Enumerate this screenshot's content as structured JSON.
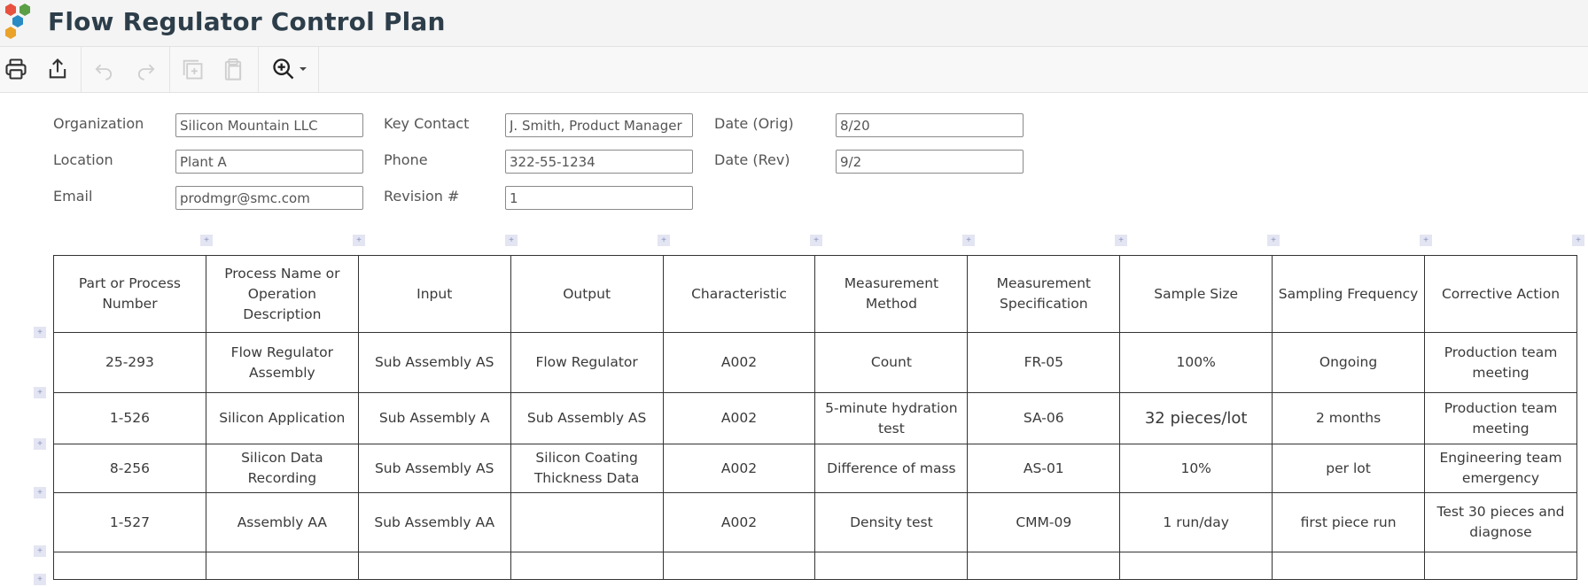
{
  "app": {
    "title": "Flow Regulator Control Plan",
    "logo_icon": "hexagon-cluster-logo",
    "logo_colors": [
      "#e8513f",
      "#5a9e46",
      "#2a8bc4",
      "#eba22a"
    ]
  },
  "toolbar": {
    "buttons": [
      {
        "name": "print",
        "icon": "printer-icon",
        "enabled": true
      },
      {
        "name": "share",
        "icon": "share-icon",
        "enabled": true
      },
      {
        "name": "undo",
        "icon": "undo-icon",
        "enabled": false
      },
      {
        "name": "redo",
        "icon": "redo-icon",
        "enabled": false
      },
      {
        "name": "duplicate",
        "icon": "duplicate-icon",
        "enabled": false
      },
      {
        "name": "paste",
        "icon": "paste-icon",
        "enabled": false
      },
      {
        "name": "zoom",
        "icon": "zoom-in-icon",
        "enabled": true,
        "has_dropdown": true
      }
    ]
  },
  "form": {
    "organization": {
      "label": "Organization",
      "value": "Silicon Mountain LLC"
    },
    "location": {
      "label": "Location",
      "value": "Plant A"
    },
    "email": {
      "label": "Email",
      "value": "prodmgr@smc.com"
    },
    "key_contact": {
      "label": "Key Contact",
      "value": "J. Smith, Product Manager"
    },
    "phone": {
      "label": "Phone",
      "value": "322-55-1234"
    },
    "revision": {
      "label": "Revision #",
      "value": "1"
    },
    "date_orig": {
      "label": "Date (Orig)",
      "value": "8/20"
    },
    "date_rev": {
      "label": "Date (Rev)",
      "value": "9/2"
    }
  },
  "table": {
    "add_glyph": "+",
    "headers": [
      "Part or Process Number",
      "Process Name or Operation Description",
      "Input",
      "Output",
      "Characteristic",
      "Measurement Method",
      "Measurement Specification",
      "Sample Size",
      "Sampling Frequency",
      "Corrective Action"
    ],
    "rows": [
      [
        "25-293",
        "Flow Regulator Assembly",
        "Sub Assembly AS",
        "Flow Regulator",
        "A002",
        "Count",
        "FR-05",
        "100%",
        "Ongoing",
        "Production team meeting"
      ],
      [
        "1-526",
        "Silicon Application",
        "Sub Assembly A",
        "Sub Assembly AS",
        "A002",
        "5-minute hydration test",
        "SA-06",
        "32 pieces/lot",
        "2 months",
        "Production team meeting"
      ],
      [
        "8-256",
        "Silicon Data Recording",
        "Sub Assembly AS",
        "Silicon Coating Thickness Data",
        "A002",
        "Difference of mass",
        "AS-01",
        "10%",
        "per lot",
        "Engineering team emergency"
      ],
      [
        "1-527",
        "Assembly AA",
        "Sub Assembly AA",
        "",
        "A002",
        "Density test",
        "CMM-09",
        "1 run/day",
        "first piece run",
        "Test 30 pieces and diagnose"
      ],
      [
        "",
        "",
        "",
        "",
        "",
        "",
        "",
        "",
        "",
        ""
      ]
    ]
  }
}
